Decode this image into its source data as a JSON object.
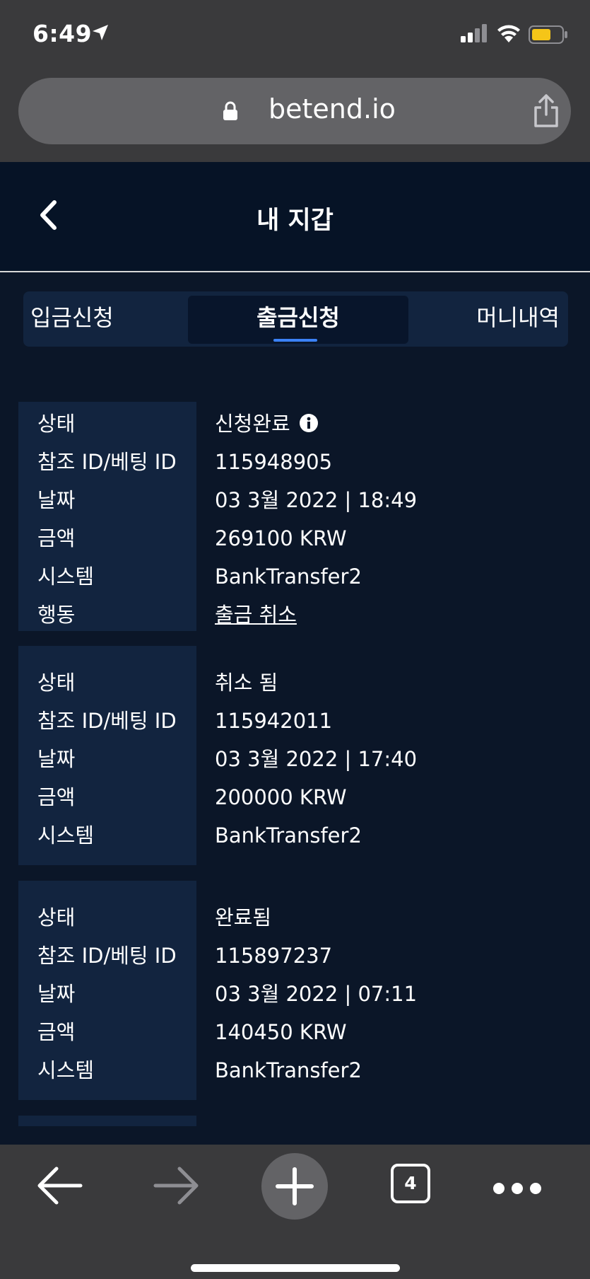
{
  "status_bar": {
    "time": "6:49",
    "icons": [
      "location-arrow-icon",
      "cellular-signal-icon",
      "wifi-icon",
      "battery-icon"
    ],
    "battery_color": "#f5c518"
  },
  "browser": {
    "url": "betend.io",
    "tab_count": "4"
  },
  "header": {
    "title": "내 지갑"
  },
  "tabs": [
    {
      "label": "입금신청",
      "active": false
    },
    {
      "label": "출금신청",
      "active": true
    },
    {
      "label": "머니내역",
      "active": false
    }
  ],
  "labels": {
    "status": "상태",
    "reference_id": "참조 ID/베팅 ID",
    "date": "날짜",
    "amount": "금액",
    "system": "시스템",
    "action": "행동"
  },
  "records": [
    {
      "status": "신청완료",
      "reference_id": "115948905",
      "date": "03 3월 2022 | 18:49",
      "amount": "269100 KRW",
      "system": "BankTransfer2",
      "action": "출금 취소"
    },
    {
      "status": "취소 됨",
      "reference_id": "115942011",
      "date": "03 3월 2022 | 17:40",
      "amount": "200000 KRW",
      "system": "BankTransfer2"
    },
    {
      "status": "완료됨",
      "reference_id": "115897237",
      "date": "03 3월 2022 | 07:11",
      "amount": "140450 KRW",
      "system": "BankTransfer2"
    }
  ],
  "colors": {
    "background": "#0b1628",
    "label_panel": "#12243f",
    "accent": "#3b82f6",
    "cancel_link": "#ff3b30"
  }
}
